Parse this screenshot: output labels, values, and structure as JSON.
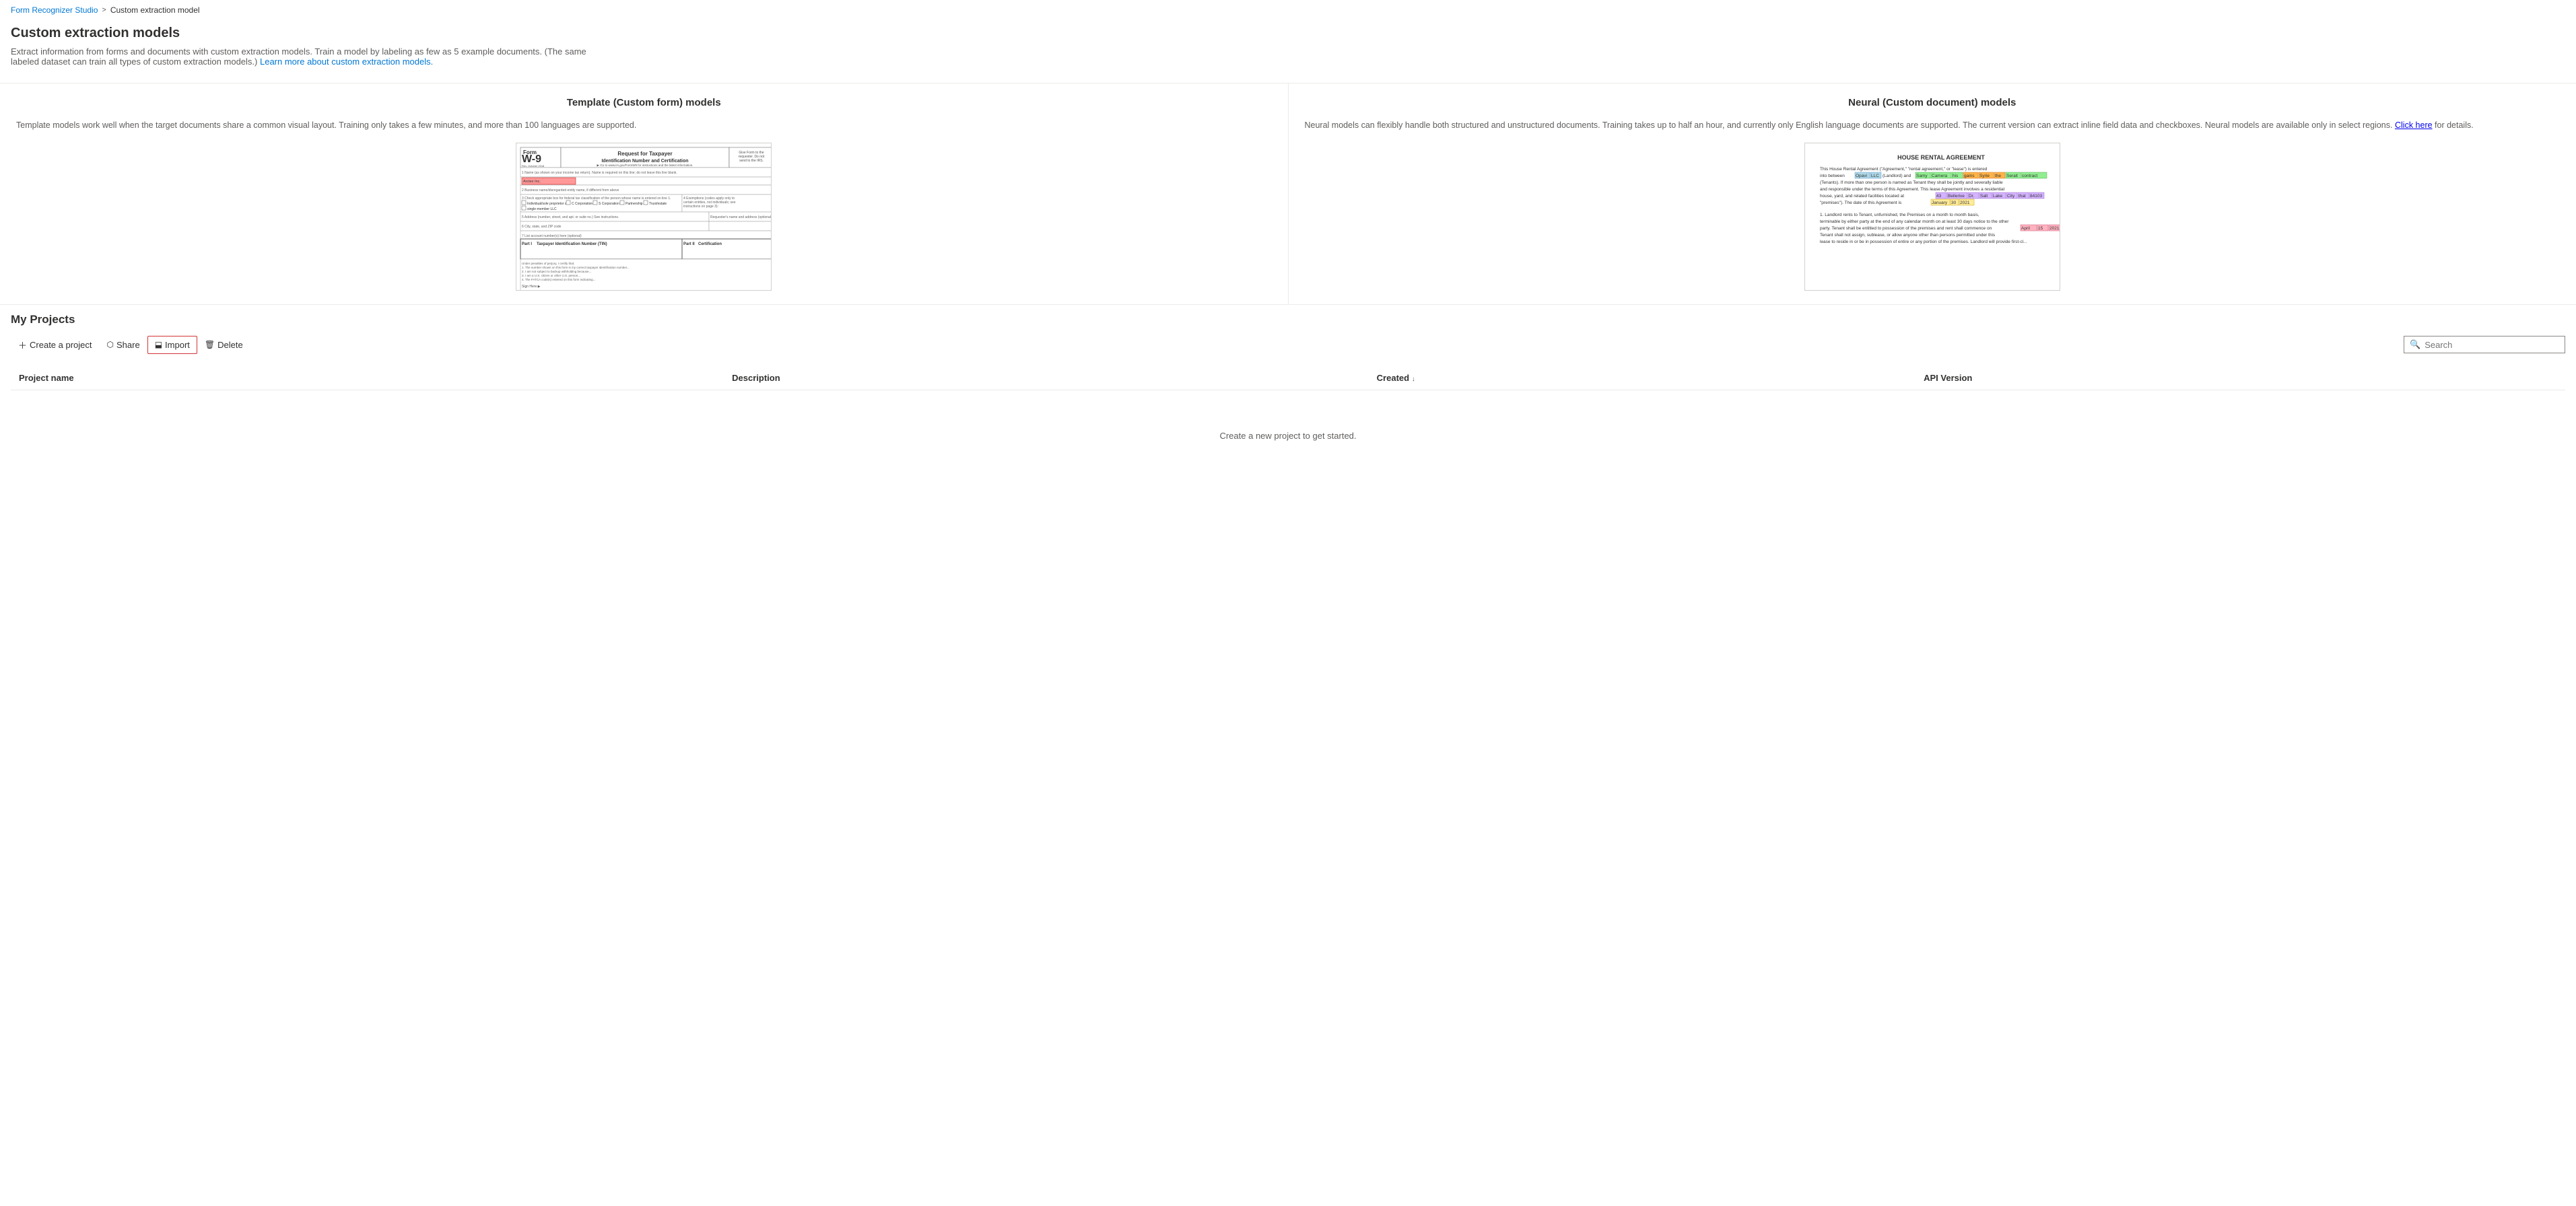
{
  "breadcrumb": {
    "home": "Form Recognizer Studio",
    "separator": ">",
    "current": "Custom extraction model"
  },
  "page": {
    "title": "Custom extraction models",
    "description": "Extract information from forms and documents with custom extraction models. Train a model by labeling as few as 5 example documents. (The same labeled dataset can train all types of custom extraction models.)",
    "learn_more_text": "Learn more about custom extraction models.",
    "learn_more_href": "#"
  },
  "models": {
    "template": {
      "title": "Template (Custom form) models",
      "description": "Template models work well when the target documents share a common visual layout. Training only takes a few minutes, and more than 100 languages are supported."
    },
    "neural": {
      "title": "Neural (Custom document) models",
      "description": "Neural models can flexibly handle both structured and unstructured documents. Training takes up to half an hour, and currently only English language documents are supported. The current version can extract inline field data and checkboxes. Neural models are available only in select regions.",
      "click_here_text": "Click here",
      "click_here_href": "#",
      "for_details": "for details."
    }
  },
  "projects": {
    "title": "My Projects",
    "toolbar": {
      "create_label": "Create a project",
      "share_label": "Share",
      "import_label": "Import",
      "delete_label": "Delete"
    },
    "table": {
      "columns": [
        {
          "key": "name",
          "label": "Project name"
        },
        {
          "key": "description",
          "label": "Description"
        },
        {
          "key": "created",
          "label": "Created"
        },
        {
          "key": "api_version",
          "label": "API Version"
        }
      ],
      "rows": []
    },
    "empty_message": "Create a new project to get started.",
    "search": {
      "placeholder": "Search"
    }
  },
  "icons": {
    "plus": "+",
    "share": "↗",
    "import": "⬓",
    "delete": "🗑",
    "search": "🔍",
    "breadcrumb_arrow": "›"
  }
}
